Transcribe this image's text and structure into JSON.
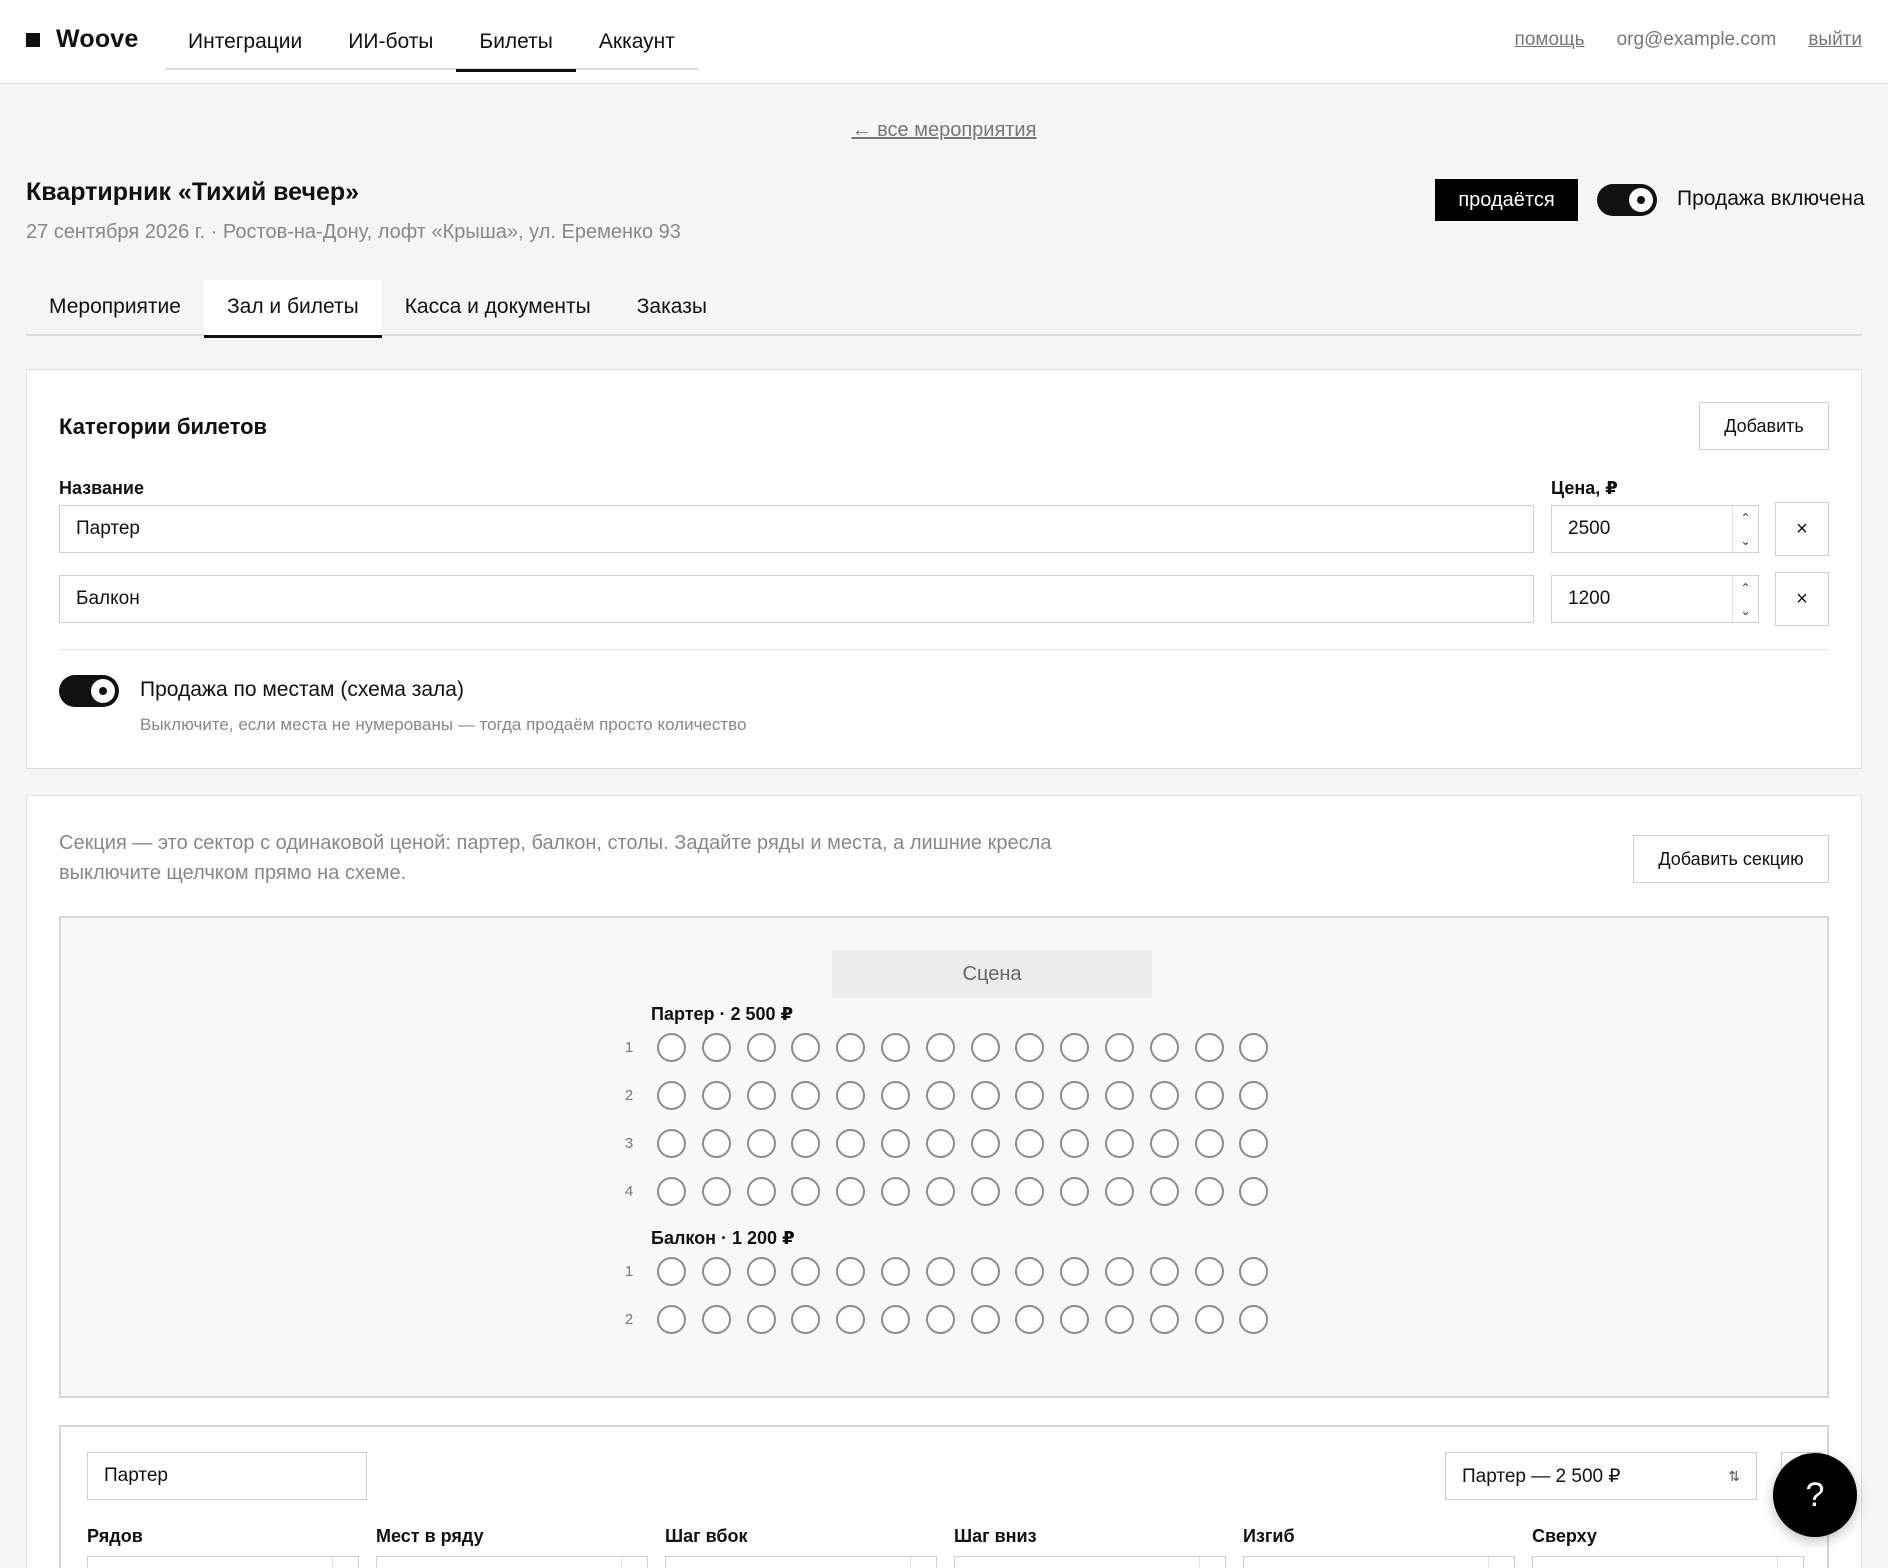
{
  "header": {
    "logo": "Woove",
    "nav": [
      "Интеграции",
      "ИИ-боты",
      "Билеты",
      "Аккаунт"
    ],
    "active_nav": "Билеты",
    "help": "помощь",
    "email": "org@example.com",
    "logout": "выйти"
  },
  "back_link": "← все мероприятия",
  "event": {
    "title": "Квартирник «Тихий вечер»",
    "meta": "27 сентября 2026 г. · Ростов-на-Дону, лофт «Крыша», ул. Еременко 93",
    "status": "продаётся",
    "sale_toggle_label": "Продажа включена",
    "sale_enabled": true
  },
  "tabs": [
    "Мероприятие",
    "Зал и билеты",
    "Касса и документы",
    "Заказы"
  ],
  "active_tab": "Зал и билеты",
  "categories": {
    "title": "Категории билетов",
    "add_label": "Добавить",
    "name_label": "Название",
    "price_label": "Цена, ₽",
    "items": [
      {
        "name": "Партер",
        "price": "2500",
        "remove": "×"
      },
      {
        "name": "Балкон",
        "price": "1200",
        "remove": "×"
      }
    ],
    "seating_toggle_label": "Продажа по местам (схема зала)",
    "seating_toggle_hint": "Выключите, если места не нумерованы — тогда продаём просто количество",
    "seating_enabled": true
  },
  "sections": {
    "hint": "Секция — это сектор с одинаковой ценой: партер, балкон, столы. Задайте ряды и места, а лишние кресла выключите щелчком прямо на схеме.",
    "add_label": "Добавить секцию",
    "stage": "Сцена",
    "hall": [
      {
        "title": "Партер · 2 500 ₽",
        "rows": [
          "1",
          "2",
          "3",
          "4"
        ],
        "seats_per_row": 14
      },
      {
        "title": "Балкон · 1 200 ₽",
        "rows": [
          "1",
          "2"
        ],
        "seats_per_row": 14
      }
    ],
    "editor": {
      "name": "Партер",
      "category": "Партер — 2 500 ₽",
      "params": [
        "Рядов",
        "Мест в ряду",
        "Шаг вбок",
        "Шаг вниз",
        "Изгиб",
        "Сверху"
      ]
    }
  },
  "help_fab": "?",
  "icons": {
    "spin_up": "up-chevron-icon",
    "spin_down": "down-chevron-icon",
    "select": "updown-chevron-icon"
  }
}
